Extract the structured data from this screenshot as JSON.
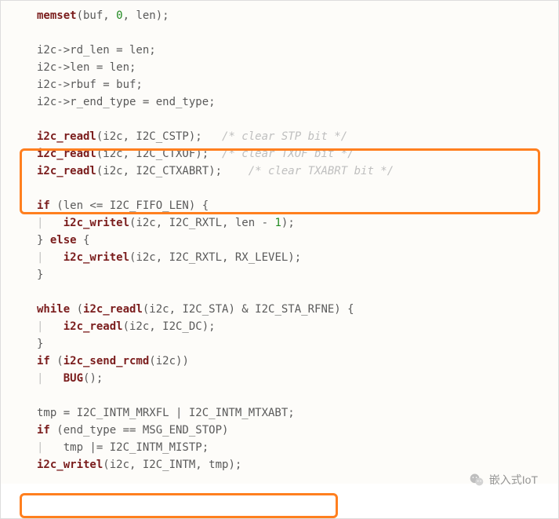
{
  "code": {
    "lines": [
      [
        [
          "fn",
          "memset"
        ],
        [
          "plain",
          "(buf, "
        ],
        [
          "num",
          "0"
        ],
        [
          "plain",
          ", len);"
        ]
      ],
      [],
      [
        [
          "plain",
          "i2c->rd_len = len;"
        ]
      ],
      [
        [
          "plain",
          "i2c->len = len;"
        ]
      ],
      [
        [
          "plain",
          "i2c->rbuf = buf;"
        ]
      ],
      [
        [
          "plain",
          "i2c->r_end_type = end_type;"
        ]
      ],
      [],
      [
        [
          "fn",
          "i2c_readl"
        ],
        [
          "plain",
          "(i2c, I2C_CSTP);   "
        ],
        [
          "cmt",
          "/* clear STP bit */"
        ]
      ],
      [
        [
          "fn",
          "i2c_readl"
        ],
        [
          "plain",
          "(i2c, I2C_CTXOF);  "
        ],
        [
          "cmt",
          "/* clear TXOF bit */"
        ]
      ],
      [
        [
          "fn",
          "i2c_readl"
        ],
        [
          "plain",
          "(i2c, I2C_CTXABRT);    "
        ],
        [
          "cmt",
          "/* clear TXABRT bit */"
        ]
      ],
      [],
      [
        [
          "kw",
          "if"
        ],
        [
          "plain",
          " (len <= I2C_FIFO_LEN) {"
        ]
      ],
      [
        [
          "bar",
          "|   "
        ],
        [
          "fn",
          "i2c_writel"
        ],
        [
          "plain",
          "(i2c, I2C_RXTL, len - "
        ],
        [
          "num",
          "1"
        ],
        [
          "plain",
          ");"
        ]
      ],
      [
        [
          "plain",
          "} "
        ],
        [
          "kw",
          "else"
        ],
        [
          "plain",
          " {"
        ]
      ],
      [
        [
          "bar",
          "|   "
        ],
        [
          "fn",
          "i2c_writel"
        ],
        [
          "plain",
          "(i2c, I2C_RXTL, RX_LEVEL);"
        ]
      ],
      [
        [
          "plain",
          "}"
        ]
      ],
      [],
      [
        [
          "kw",
          "while"
        ],
        [
          "plain",
          " ("
        ],
        [
          "fn",
          "i2c_readl"
        ],
        [
          "plain",
          "(i2c, I2C_STA) & I2C_STA_RFNE) {"
        ]
      ],
      [
        [
          "bar",
          "|   "
        ],
        [
          "fn",
          "i2c_readl"
        ],
        [
          "plain",
          "(i2c, I2C_DC);"
        ]
      ],
      [
        [
          "plain",
          "}"
        ]
      ],
      [
        [
          "kw",
          "if"
        ],
        [
          "plain",
          " ("
        ],
        [
          "fn",
          "i2c_send_rcmd"
        ],
        [
          "plain",
          "(i2c))"
        ]
      ],
      [
        [
          "bar",
          "|   "
        ],
        [
          "fn",
          "BUG"
        ],
        [
          "plain",
          "();"
        ]
      ],
      [],
      [
        [
          "plain",
          "tmp = I2C_INTM_MRXFL | I2C_INTM_MTXABT;"
        ]
      ],
      [
        [
          "kw",
          "if"
        ],
        [
          "plain",
          " (end_type == MSG_END_STOP)"
        ]
      ],
      [
        [
          "bar",
          "|   "
        ],
        [
          "plain",
          "tmp |= I2C_INTM_MISTP;"
        ]
      ],
      [
        [
          "fn",
          "i2c_writel"
        ],
        [
          "plain",
          "(i2c, I2C_INTM, tmp);"
        ]
      ]
    ]
  },
  "watermark": {
    "text": "嵌入式IoT"
  }
}
